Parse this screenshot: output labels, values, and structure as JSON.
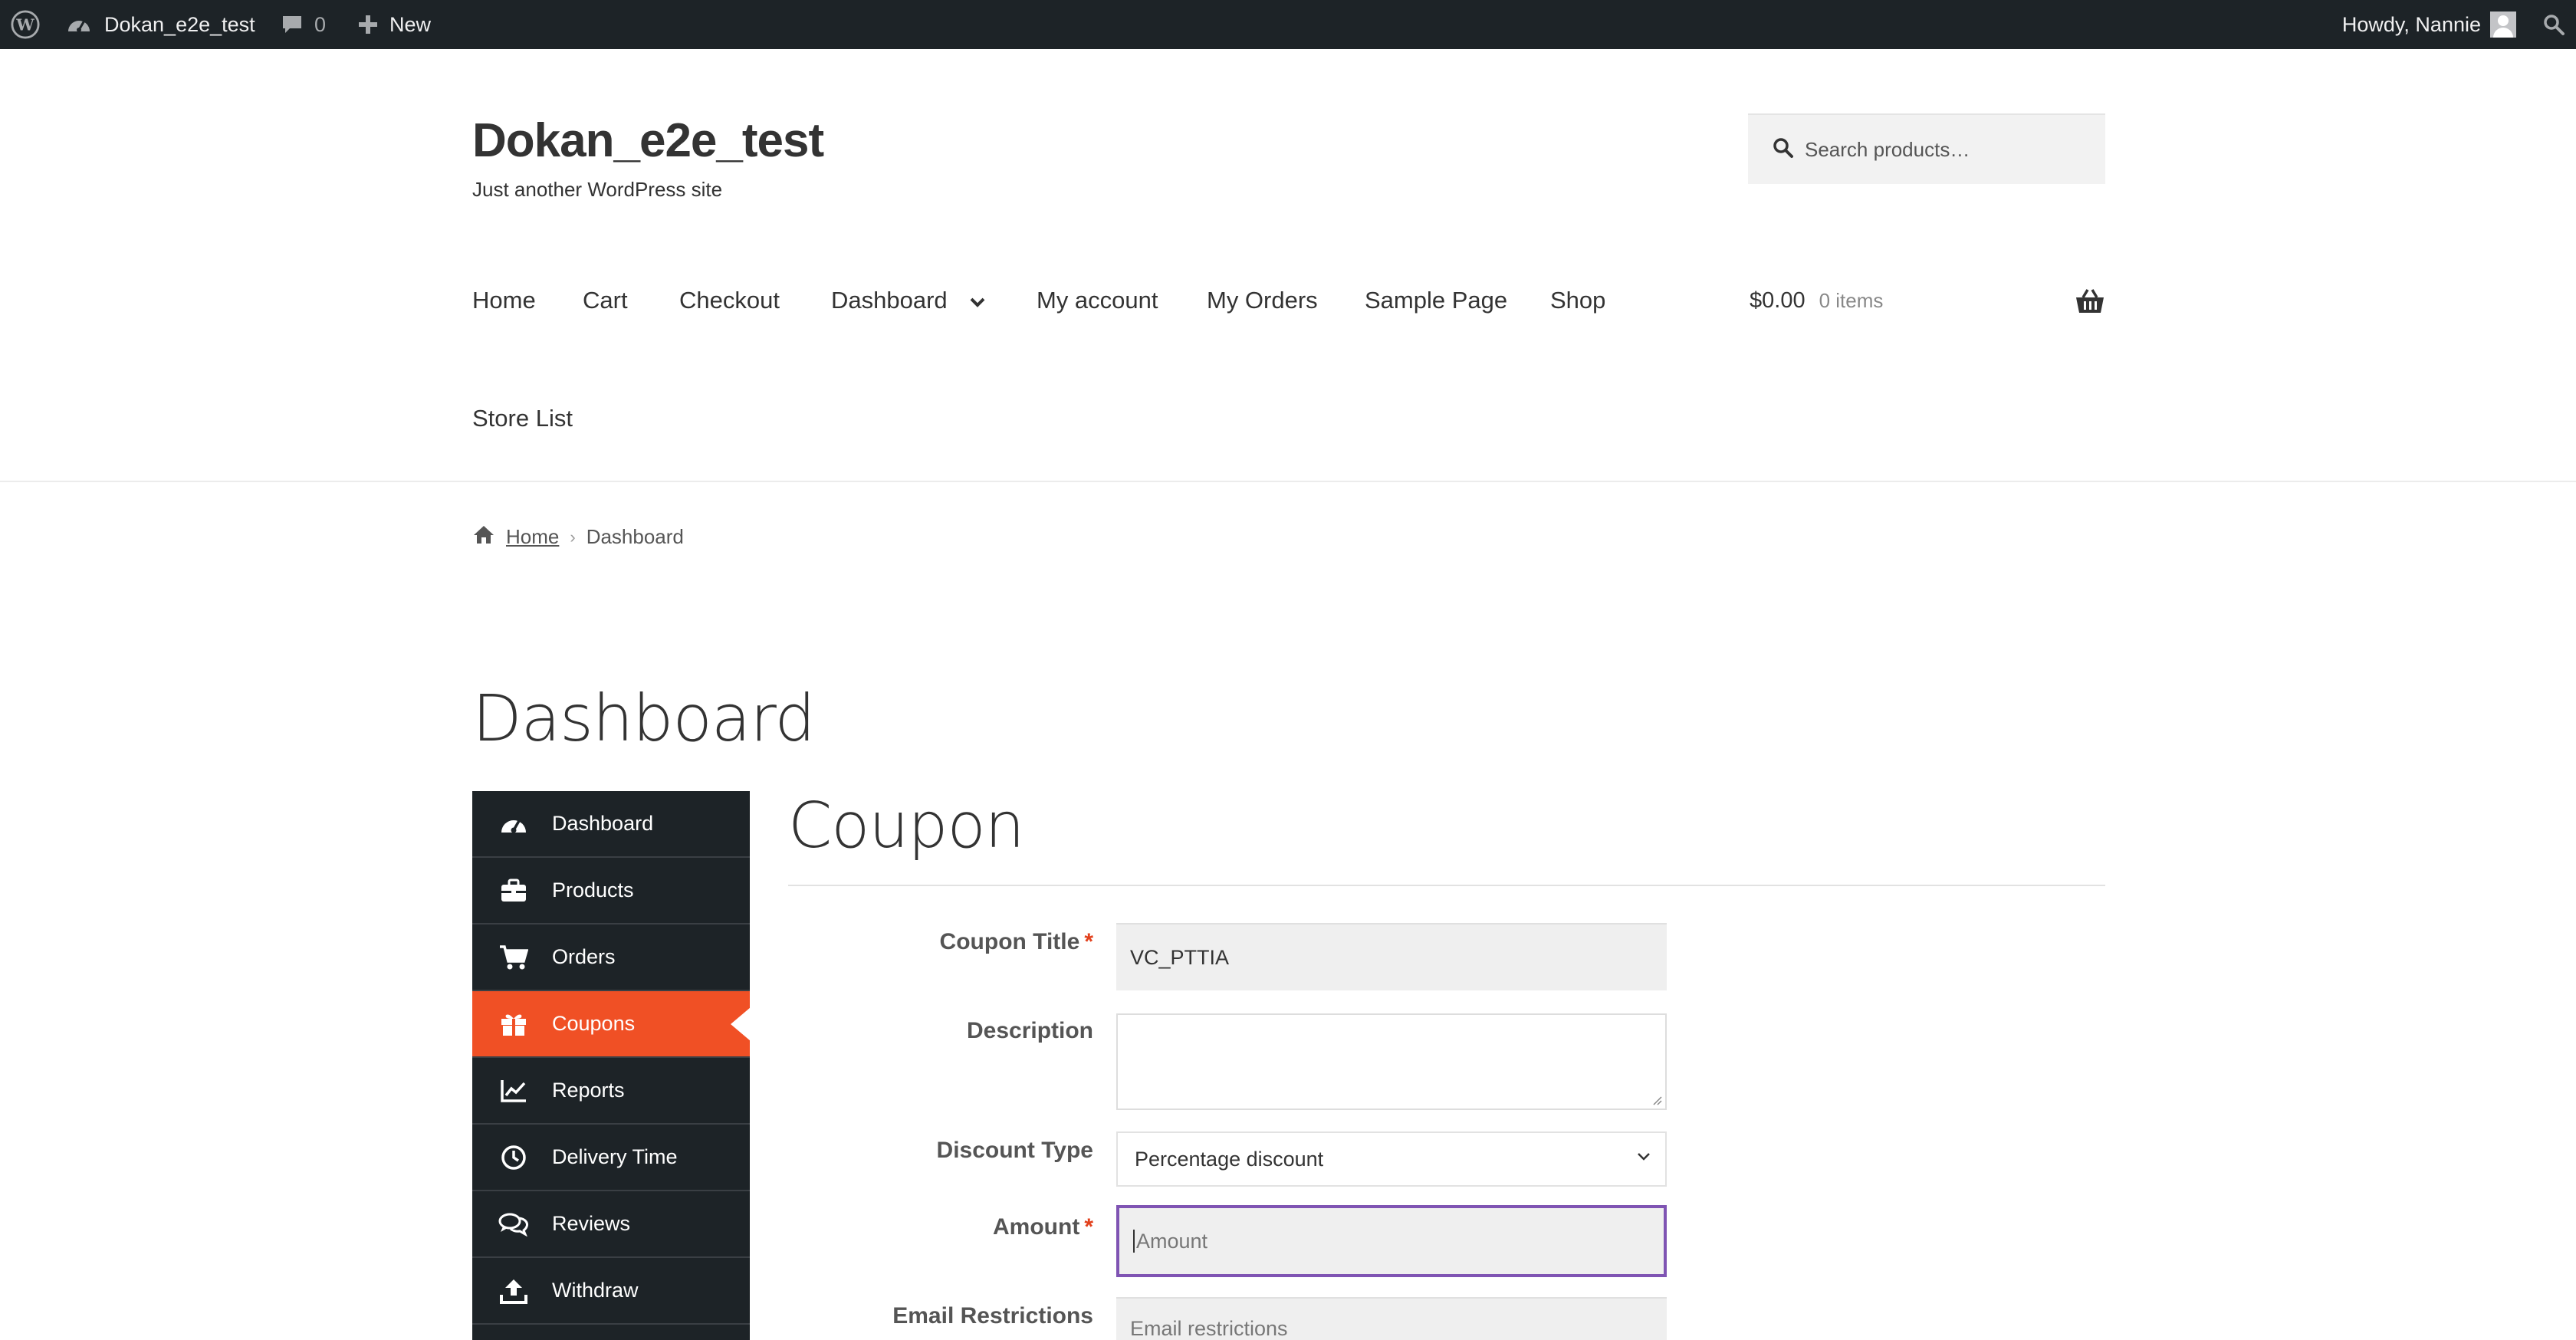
{
  "admin_bar": {
    "site_name": "Dokan_e2e_test",
    "comments_count": "0",
    "new_label": "New",
    "greeting": "Howdy, Nannie"
  },
  "header": {
    "site_title": "Dokan_e2e_test",
    "tagline": "Just another WordPress site",
    "search_placeholder": "Search products…"
  },
  "nav": {
    "items": [
      "Home",
      "Cart",
      "Checkout",
      "Dashboard",
      "My account",
      "My Orders",
      "Sample Page",
      "Shop",
      "Store List"
    ],
    "cart_total": "$0.00",
    "cart_count": "0 items"
  },
  "breadcrumb": {
    "home": "Home",
    "current": "Dashboard"
  },
  "page_title": "Dashboard",
  "sidebar": {
    "items": [
      "Dashboard",
      "Products",
      "Orders",
      "Coupons",
      "Reports",
      "Delivery Time",
      "Reviews",
      "Withdraw"
    ],
    "active": "Coupons",
    "icons": [
      "dashboard-gauge-icon",
      "briefcase-icon",
      "shopping-cart-icon",
      "gift-icon",
      "line-chart-icon",
      "clock-icon",
      "comments-icon",
      "upload-icon"
    ]
  },
  "coupon_form": {
    "heading": "Coupon",
    "title_label": "Coupon Title",
    "title_value": "VC_PTTIA",
    "description_label": "Description",
    "description_value": "",
    "discount_type_label": "Discount Type",
    "discount_type_value": "Percentage discount",
    "amount_label": "Amount",
    "amount_placeholder": "Amount",
    "email_label": "Email Restrictions",
    "email_placeholder": "Email restrictions",
    "required_mark": "*"
  },
  "colors": {
    "admin_bar_bg": "#1d2327",
    "sidebar_bg": "#1d2327",
    "active_accent": "#f05025",
    "focus_border": "#7f54b3",
    "required": "#e2401c"
  }
}
